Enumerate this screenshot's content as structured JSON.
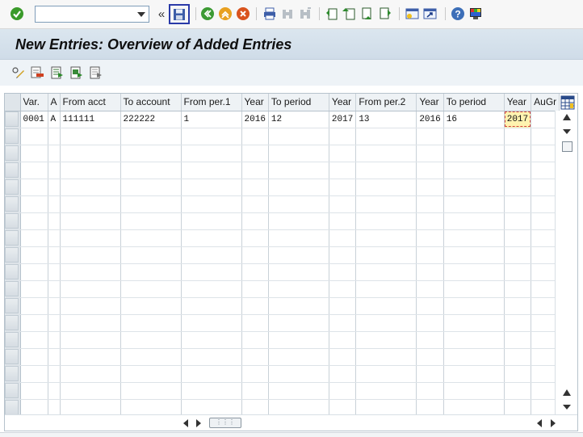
{
  "toolbar": {
    "command_value": "",
    "back_chevron": "«",
    "icons": [
      "enter-icon",
      "save-icon",
      "back-icon",
      "exit-icon",
      "cancel-icon",
      "print-icon",
      "find-icon",
      "find-next-icon",
      "first-page-icon",
      "previous-page-icon",
      "next-page-icon",
      "last-page-icon",
      "create-session-icon",
      "shortcut-icon",
      "help-icon",
      "layout-icon"
    ]
  },
  "title": "New Entries: Overview of Added Entries",
  "app_toolbar": {
    "icons": [
      "change-display-icon",
      "delete-icon",
      "select-all-icon",
      "select-block-icon",
      "deselect-all-icon"
    ]
  },
  "table": {
    "columns": [
      "Var.",
      "A",
      "From acct",
      "To account",
      "From per.1",
      "Year",
      "To period",
      "Year",
      "From per.2",
      "Year",
      "To period",
      "Year",
      "AuGr"
    ],
    "rows": [
      [
        "0001",
        "A",
        "111111",
        "222222",
        "1",
        "2016",
        "12",
        "2017",
        "13",
        "2016",
        "16",
        "2017",
        ""
      ]
    ],
    "empty_rows": 17
  },
  "colors": {
    "title_bg": "#d5e1eb",
    "save_highlight": "#2a3aa8",
    "current_cell": "#fff3b0"
  }
}
